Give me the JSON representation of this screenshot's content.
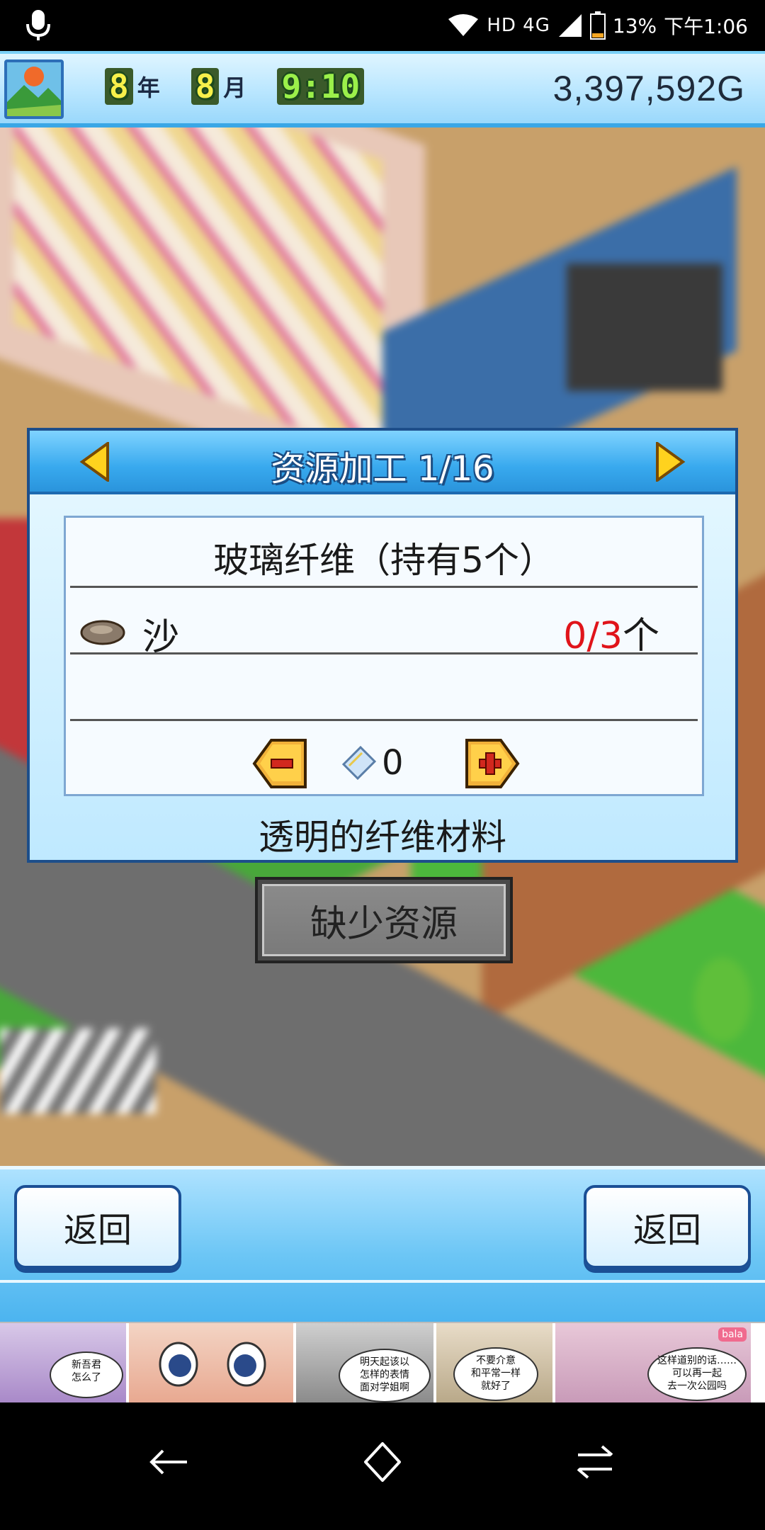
{
  "status_bar": {
    "network": "HD 4G",
    "battery": "13%",
    "time": "下午1:06"
  },
  "hud": {
    "year_value": "8",
    "year_unit": "年",
    "month_value": "8",
    "month_unit": "月",
    "time": "9:10",
    "money": "3,397,592G"
  },
  "dialog": {
    "title": "资源加工 1/16",
    "item_name": "玻璃纤维（持有5个）",
    "requirement": {
      "name": "沙",
      "have": "0",
      "need_suffix": "/3",
      "unit": "个"
    },
    "quantity": "0",
    "description": "透明的纤维材料"
  },
  "missing_button": "缺少资源",
  "bottom_bar": {
    "back_left": "返回",
    "back_right": "返回"
  },
  "ad": {
    "logo": "bala",
    "bubbles": [
      "新吾君\n怎么了",
      "明天起该以\n怎样的表情\n面对学姐啊",
      "不要介意\n和平常一样\n就好了",
      "这样道别的话……\n可以再一起\n去一次公园吗"
    ]
  },
  "colors": {
    "dialog_header": "#38a9ee",
    "requirement_missing": "#e0141a",
    "money_text": "#1e2a3a"
  }
}
